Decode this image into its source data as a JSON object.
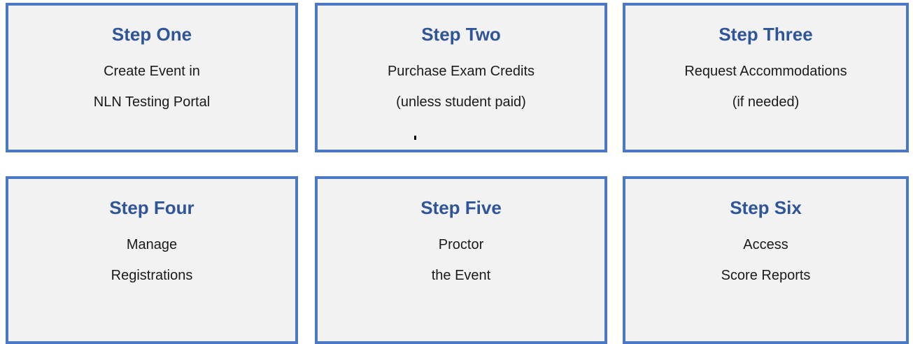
{
  "steps": [
    {
      "title": "Step One",
      "line1": "Create Event in",
      "line2": "NLN Testing Portal"
    },
    {
      "title": "Step Two",
      "line1": "Purchase Exam Credits",
      "line2": "(unless student paid)"
    },
    {
      "title": "Step Three",
      "line1": "Request Accommodations",
      "line2": "(if needed)"
    },
    {
      "title": "Step Four",
      "line1": "Manage",
      "line2": "Registrations"
    },
    {
      "title": "Step Five",
      "line1": "Proctor",
      "line2": "the Event"
    },
    {
      "title": "Step Six",
      "line1": "Access",
      "line2": "Score Reports"
    }
  ],
  "colors": {
    "border": "#4a78c5",
    "title": "#2f5597",
    "card_background": "#f2f2f2"
  }
}
